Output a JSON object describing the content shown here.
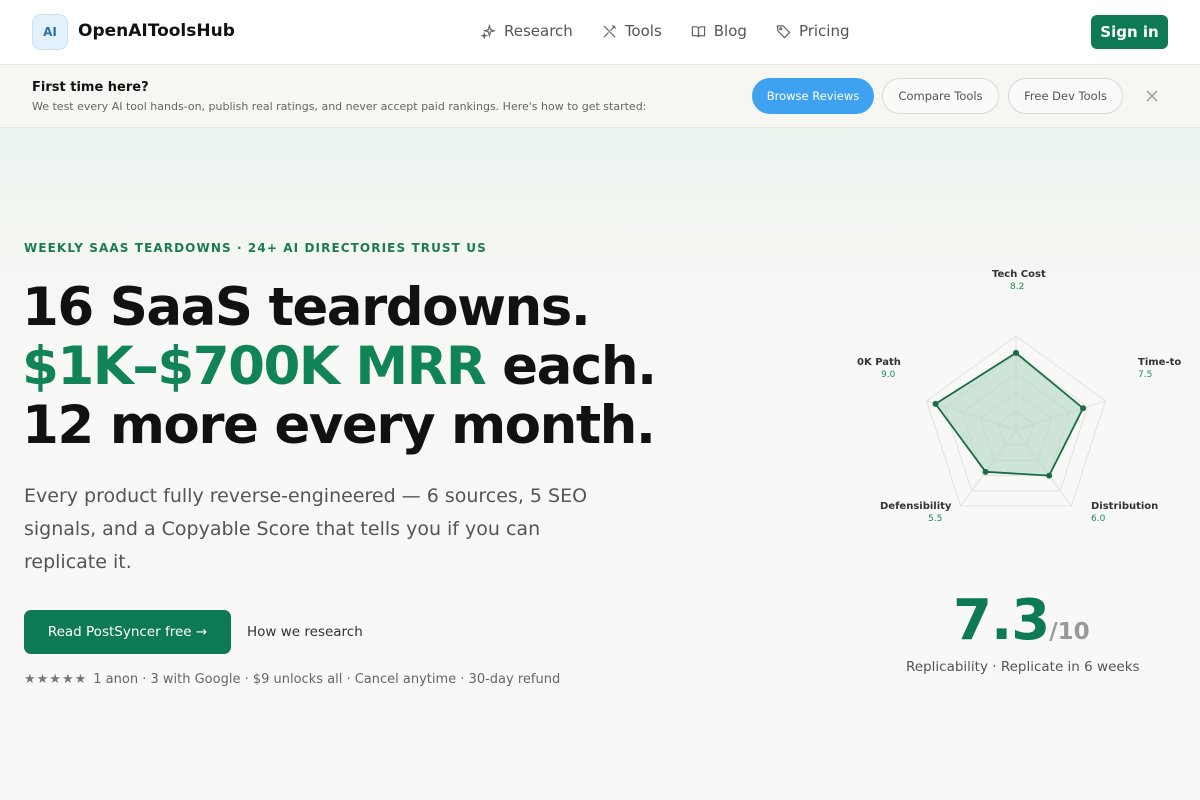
{
  "nav": {
    "logo_text": "AI",
    "brand": "OpenAIToolsHub",
    "links": [
      {
        "label": "Research",
        "icon": "sparkles-icon"
      },
      {
        "label": "Tools",
        "icon": "wrench-icon"
      },
      {
        "label": "Blog",
        "icon": "book-icon"
      },
      {
        "label": "Pricing",
        "icon": "tag-icon"
      }
    ],
    "signin_label": "Sign in"
  },
  "banner": {
    "title": "First time here?",
    "text": "We test every AI tool hands-on, publish real ratings, and never accept paid rankings. Here's how to get started:",
    "buttons": [
      "Browse Reviews",
      "Compare Tools",
      "Free Dev Tools"
    ]
  },
  "hero": {
    "eyebrow": "WEEKLY SAAS TEARDOWNS · 24+ AI DIRECTORIES TRUST US",
    "headline_line1": "16 SaaS teardowns.",
    "headline_green": "$1K–$700K MRR",
    "headline_line2_rest": " each.",
    "headline_line3": "12 more every month.",
    "subtitle": "Every product fully reverse-engineered — 6 sources, 5 SEO signals, and a Copyable Score that tells you if you can replicate it.",
    "cta_label": "Read PostSyncer free →",
    "secondary_link": "How we research",
    "stars": "★★★★★",
    "trust_text": "1 anon · 3 with Google · $9 unlocks all · Cancel anytime · 30-day refund"
  },
  "radar": {
    "max": 10,
    "axes": [
      {
        "label": "Tech Cost",
        "value": "8.2"
      },
      {
        "label": "Time-to",
        "value": "7.5"
      },
      {
        "label": "Distribution",
        "value": "6.0"
      },
      {
        "label": "Defensibility",
        "value": "5.5"
      },
      {
        "label": "0K Path",
        "value": "9.0"
      }
    ],
    "colors": {
      "stroke": "#1b6b4a",
      "fill": "#a9d3be",
      "grid": "#e2e2de"
    }
  },
  "score": {
    "value": "7.3",
    "denominator": "/10",
    "caption": "Replicability · Replicate in 6 weeks"
  }
}
